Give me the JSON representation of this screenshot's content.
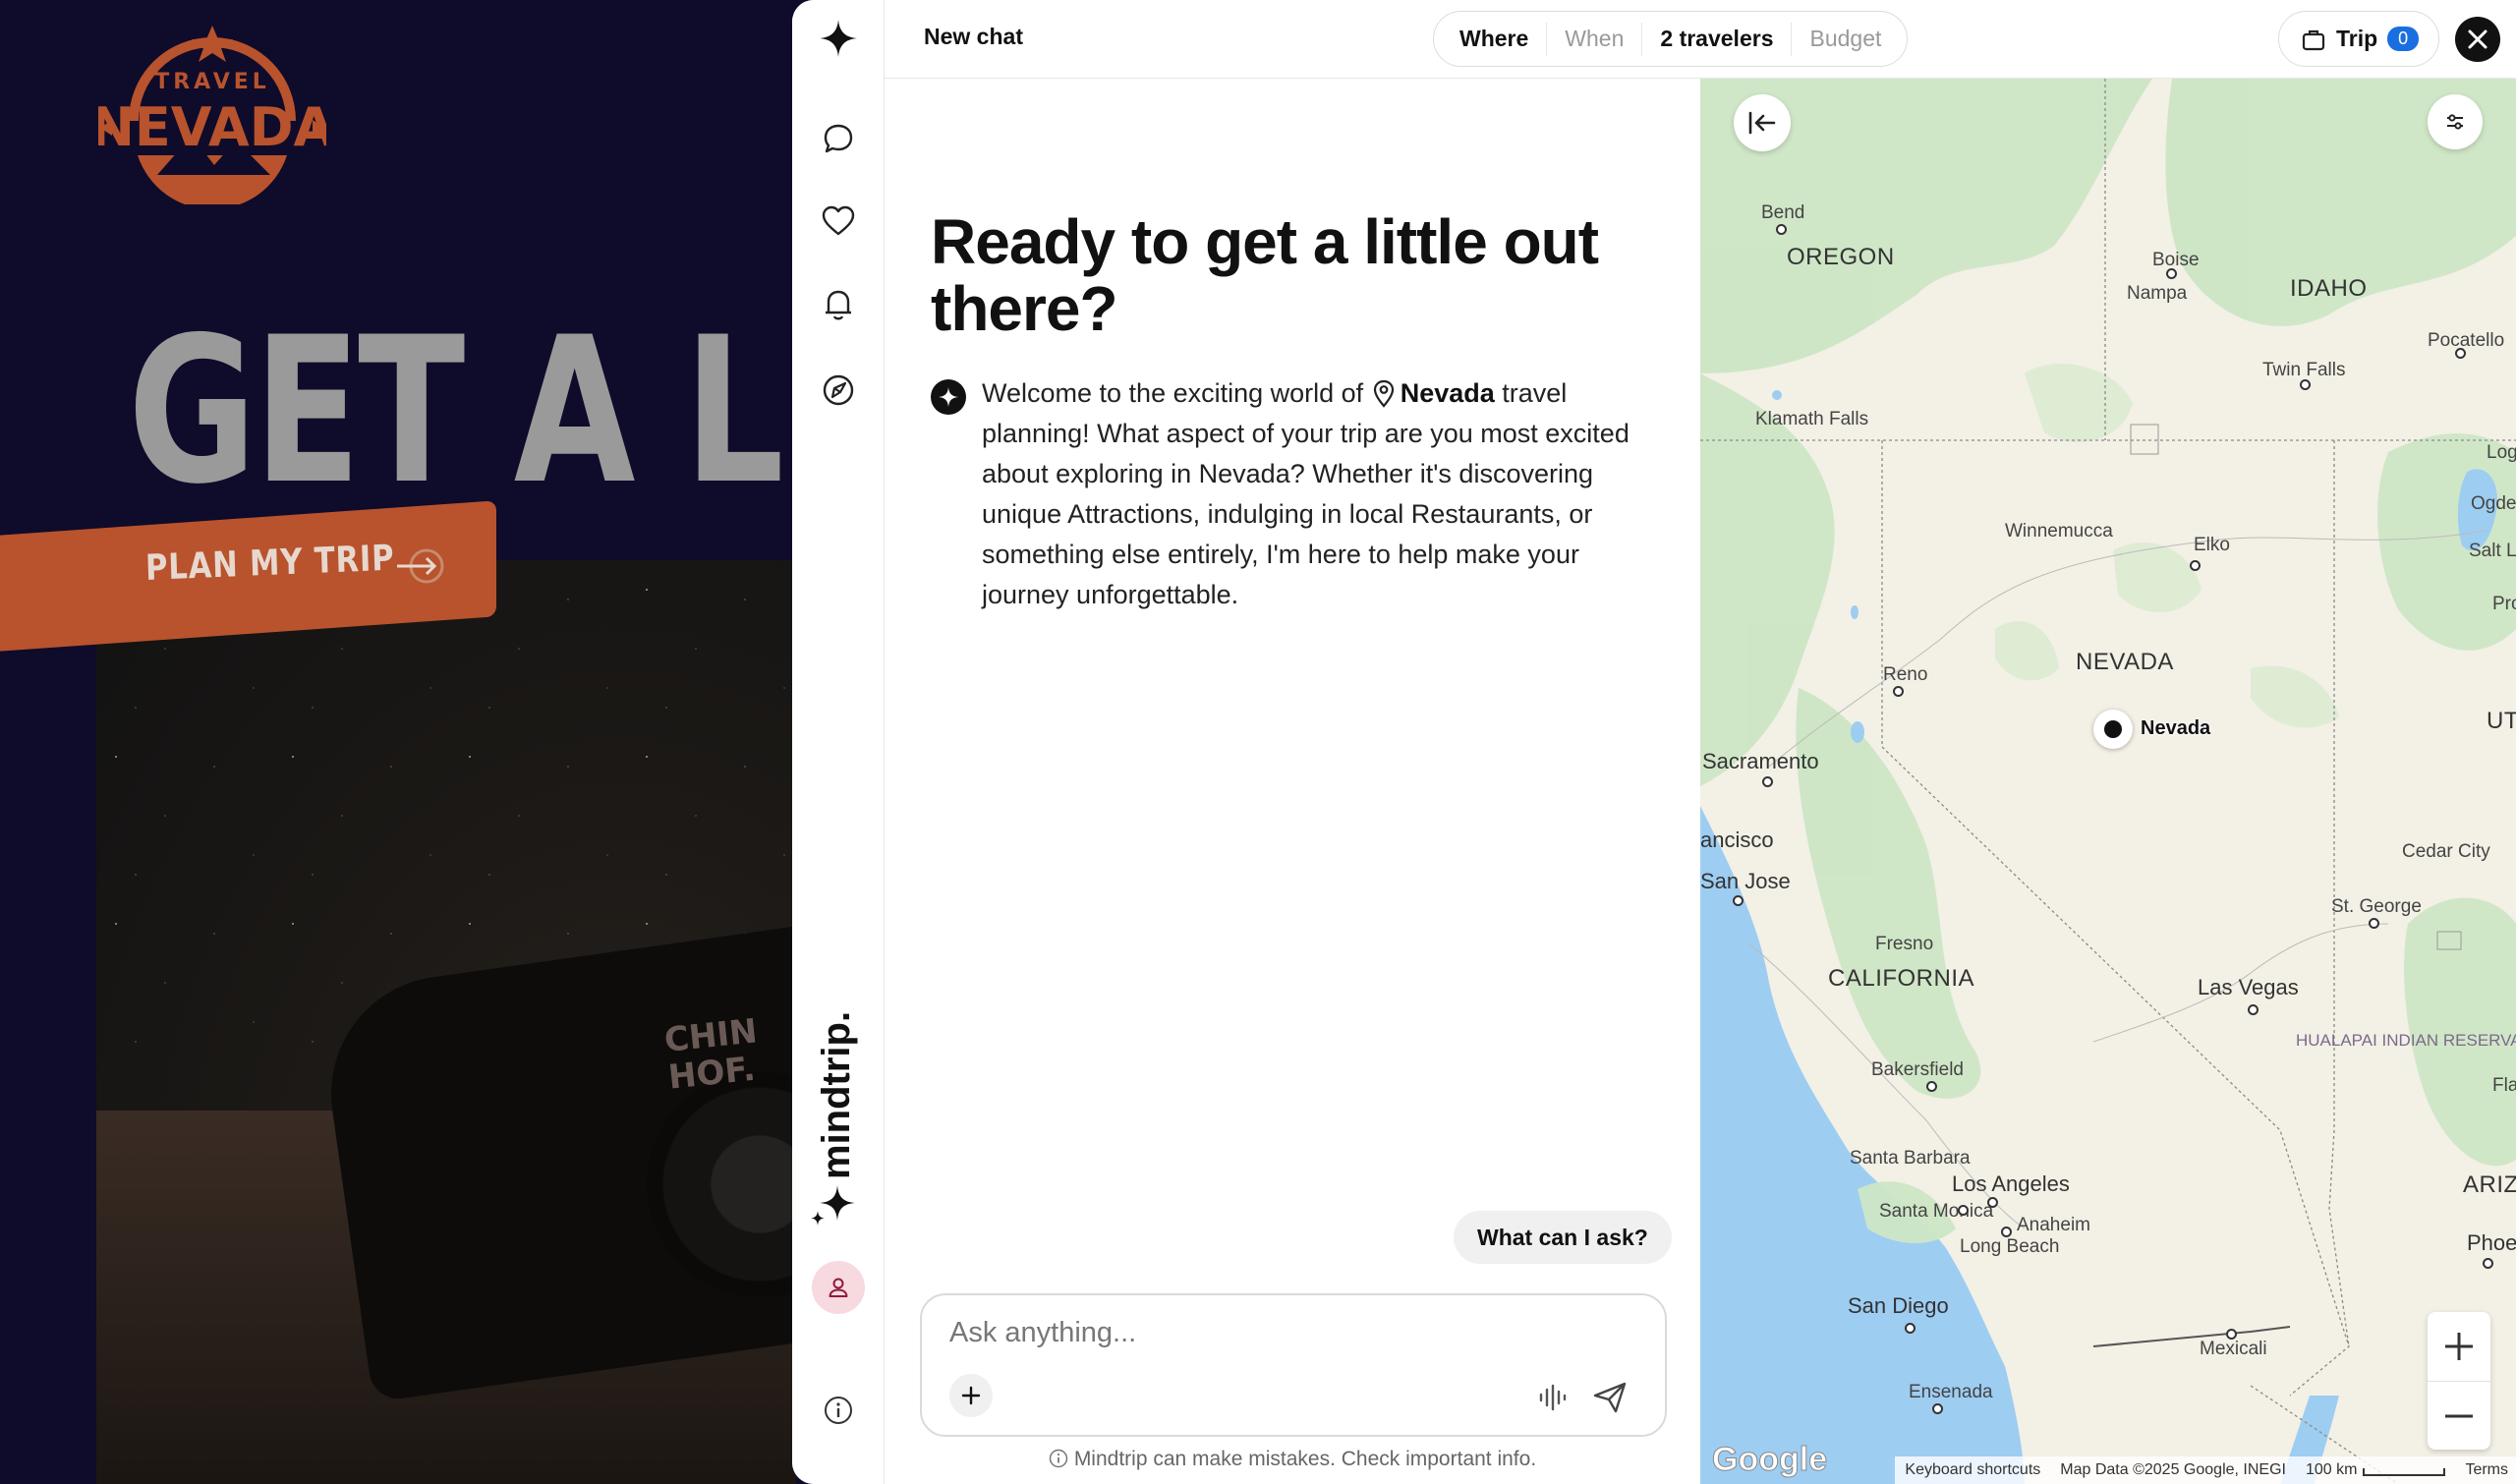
{
  "background_site": {
    "logo_top": "TRAVEL",
    "logo_main": "NEVADA",
    "hero_text": "GET A LITT",
    "plan_trip_label": "PLAN MY TRIP",
    "graffiti": "CHIN\nHOF."
  },
  "rail": {
    "brand": "mindtrip.",
    "icons": [
      "sparkle-icon",
      "chat-icon",
      "heart-icon",
      "bell-icon",
      "compass-icon",
      "user-icon",
      "info-icon"
    ]
  },
  "topbar": {
    "chat_title": "New chat",
    "filters": [
      {
        "label": "Where",
        "active": true
      },
      {
        "label": "When",
        "active": false
      },
      {
        "label": "2 travelers",
        "active": true
      },
      {
        "label": "Budget",
        "active": false
      }
    ],
    "trip_label": "Trip",
    "trip_count": "0"
  },
  "chat": {
    "heading": "Ready to get a little out there?",
    "message_before": "Welcome to the exciting world of",
    "message_place": "Nevada",
    "message_after": "travel planning! What aspect of your trip are you most excited about exploring in Nevada? Whether it's discovering unique Attractions, indulging in local Restaurants, or something else entirely, I'm here to help make your journey unforgettable.",
    "suggestion": "What can I ask?",
    "input_placeholder": "Ask anything...",
    "input_value": "",
    "disclaimer": "Mindtrip can make mistakes. Check important info."
  },
  "map": {
    "marker_label": "Nevada",
    "states": [
      "OREGON",
      "IDAHO",
      "NEVADA",
      "CALIFORNIA",
      "UTA",
      "ARIZ"
    ],
    "cities": [
      "Bend",
      "Boise",
      "Nampa",
      "Pocatello",
      "Twin Falls",
      "Klamath Falls",
      "Loga",
      "Ogden",
      "Salt Lake",
      "Pro",
      "Winnemucca",
      "Elko",
      "Reno",
      "Sacramento",
      "ancisco",
      "San Jose",
      "Cedar City",
      "St. George",
      "Fresno",
      "Las Vegas",
      "Bakersfield",
      "Flag",
      "Santa Barbara",
      "Los Angeles",
      "Santa Monica",
      "Anaheim",
      "Long Beach",
      "Phoeni",
      "San Diego",
      "Mexicali",
      "Ensenada"
    ],
    "reservation": "HUALAPAI INDIAN RESERVATION",
    "attribution": {
      "google": "Google",
      "shortcuts": "Keyboard shortcuts",
      "data": "Map Data ©2025 Google, INEGI",
      "scale": "100 km",
      "terms": "Terms"
    }
  }
}
